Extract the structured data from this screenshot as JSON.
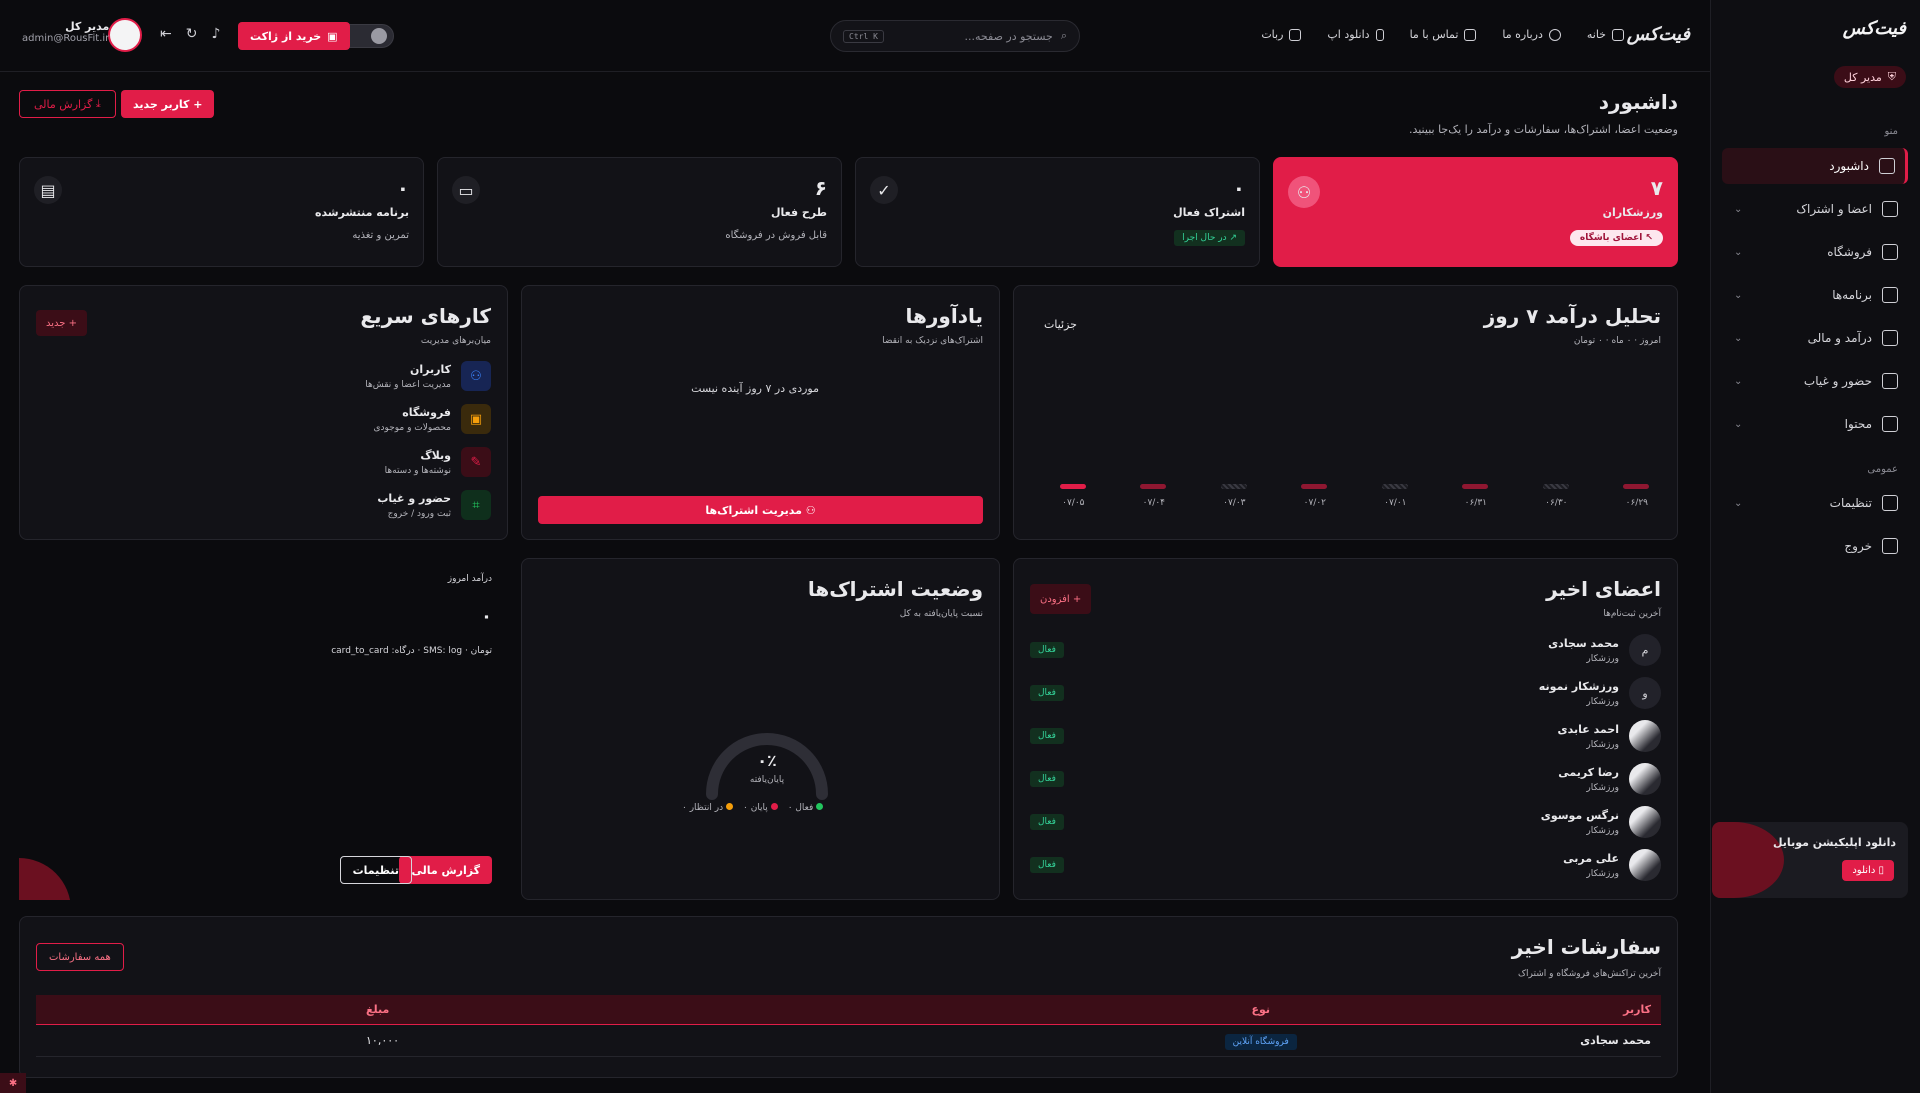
{
  "brand": {
    "logo_text": "فیت‌کس"
  },
  "sidebar": {
    "role": "مدیر کل",
    "section_menu": "منو",
    "section_general": "عمومی",
    "items": [
      {
        "label": "داشبورد",
        "icon": "dashboard-icon",
        "active": true
      },
      {
        "label": "اعضا و اشتراک",
        "icon": "users-icon"
      },
      {
        "label": "فروشگاه",
        "icon": "store-icon"
      },
      {
        "label": "برنامه‌ها",
        "icon": "program-icon"
      },
      {
        "label": "درآمد و مالی",
        "icon": "chart-icon"
      },
      {
        "label": "حضور و غیاب",
        "icon": "attendance-icon"
      },
      {
        "label": "محتوا",
        "icon": "content-icon"
      }
    ],
    "general_items": [
      {
        "label": "تنظیمات",
        "icon": "sliders-icon"
      },
      {
        "label": "خروج",
        "icon": "logout-icon"
      }
    ],
    "app_promo": {
      "title": "دانلود اپلیکیشن موبایل",
      "button": "دانلود"
    }
  },
  "topbar": {
    "nav": [
      "خانه",
      "درباره ما",
      "تماس با ما",
      "دانلود اپ",
      "ربات"
    ],
    "search_placeholder": "جستجو در صفحه...",
    "search_shortcut": "Ctrl K",
    "buy_label": "خرید از ژاکت",
    "user_name": "مدیر کل",
    "user_email": "admin@RousFit.ir"
  },
  "header": {
    "title": "داشبورد",
    "subtitle": "وضعیت اعضا، اشتراک‌ها، سفارشات و درآمد را یک‌جا ببینید.",
    "new_user": "کاربر جدید",
    "financial_report": "گزارش مالی"
  },
  "stats": [
    {
      "value": "۷",
      "label": "ورزشکاران",
      "badge": "اعضای باشگاه",
      "highlight": true,
      "icon": "users-icon"
    },
    {
      "value": "۰",
      "label": "اشتراک فعال",
      "badge": "در حال اجرا",
      "icon": "check-circle-icon"
    },
    {
      "value": "۶",
      "label": "طرح فعال",
      "sub": "قابل فروش در فروشگاه",
      "icon": "card-icon"
    },
    {
      "value": "۰",
      "label": "برنامه منتشرشده",
      "sub": "تمرین و تغذیه",
      "icon": "document-icon"
    }
  ],
  "revenue": {
    "title": "تحلیل درآمد ۷ روز",
    "subtitle": "امروز · ۰ ماه · ۰ تومان",
    "details": "جزئیات"
  },
  "chart_data": {
    "type": "bar",
    "categories": [
      "۰۶/۲۹",
      "۰۶/۳۰",
      "۰۶/۳۱",
      "۰۷/۰۱",
      "۰۷/۰۲",
      "۰۷/۰۳",
      "۰۷/۰۴",
      "۰۷/۰۵"
    ],
    "values": [
      0,
      0,
      0,
      0,
      0,
      0,
      0,
      0
    ],
    "title": "تحلیل درآمد ۷ روز"
  },
  "reminders": {
    "title": "یادآورها",
    "subtitle": "اشتراک‌های نزدیک به انقضا",
    "empty": "موردی در ۷ روز آینده نیست",
    "manage": "مدیریت اشتراک‌ها"
  },
  "quick": {
    "title": "کارهای سریع",
    "subtitle": "میان‌برهای مدیریت",
    "new": "+ جدید",
    "items": [
      {
        "title": "کاربران",
        "sub": "مدیریت اعضا و نقش‌ها",
        "color": "#3b82f6",
        "bg": "#172554"
      },
      {
        "title": "فروشگاه",
        "sub": "محصولات و موجودی",
        "color": "#f59e0b",
        "bg": "#3a2a0c"
      },
      {
        "title": "وبلاگ",
        "sub": "نوشته‌ها و دسته‌ها",
        "color": "#e11d48",
        "bg": "#3b0d17"
      },
      {
        "title": "حضور و غیاب",
        "sub": "ثبت ورود / خروج",
        "color": "#22c55e",
        "bg": "#0f2f1c"
      }
    ]
  },
  "members": {
    "title": "اعضای اخیر",
    "subtitle": "آخرین ثبت‌نام‌ها",
    "add": "+ افزودن",
    "list": [
      {
        "name": "محمد سجادی",
        "role": "ورزشکار",
        "initial": "م",
        "status": "فعال"
      },
      {
        "name": "ورزشکار نمونه",
        "role": "ورزشکار",
        "initial": "و",
        "status": "فعال"
      },
      {
        "name": "احمد عابدی",
        "role": "ورزشکار",
        "initial": "",
        "status": "فعال"
      },
      {
        "name": "رضا کریمی",
        "role": "ورزشکار",
        "initial": "",
        "status": "فعال"
      },
      {
        "name": "نرگس موسوی",
        "role": "ورزشکار",
        "initial": "",
        "status": "فعال"
      },
      {
        "name": "علی مربی",
        "role": "ورزشکار",
        "initial": "",
        "status": "فعال"
      }
    ]
  },
  "subs": {
    "title": "وضعیت اشتراک‌ها",
    "subtitle": "نسبت پایان‌یافته به کل",
    "percent": "۰٪",
    "percent_label": "پایان‌یافته",
    "legend": [
      "فعال ۰",
      "پایان ۰",
      "در انتظار ۰"
    ]
  },
  "today": {
    "label": "درآمد امروز",
    "value": "۰",
    "meta": "تومان · SMS: log · درگاه: card_to_card",
    "report": "گزارش مالی",
    "settings": "تنظیمات"
  },
  "orders": {
    "title": "سفارشات اخیر",
    "subtitle": "آخرین تراکنش‌های فروشگاه و اشتراک",
    "all": "همه سفارشات",
    "columns": [
      "کاربر",
      "نوع",
      "مبلغ"
    ],
    "rows": [
      {
        "user": "محمد سجادی",
        "type": "فروشگاه آنلاین",
        "amount": "۱۰,۰۰۰"
      }
    ]
  }
}
